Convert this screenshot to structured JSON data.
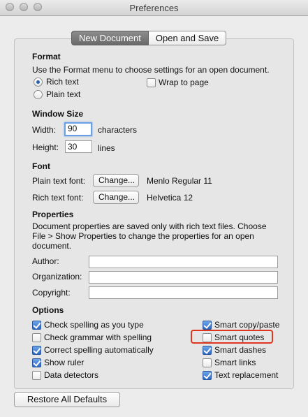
{
  "window": {
    "title": "Preferences"
  },
  "tabs": [
    {
      "label": "New Document",
      "active": true
    },
    {
      "label": "Open and Save",
      "active": false
    }
  ],
  "format": {
    "heading": "Format",
    "description": "Use the Format menu to choose settings for an open document.",
    "rich_text": "Rich text",
    "plain_text": "Plain text",
    "wrap_to_page": "Wrap to page",
    "selected": "Rich text",
    "wrap_checked": false
  },
  "window_size": {
    "heading": "Window Size",
    "width_label": "Width:",
    "width_value": "90",
    "width_unit": "characters",
    "height_label": "Height:",
    "height_value": "30",
    "height_unit": "lines"
  },
  "font": {
    "heading": "Font",
    "plain_label": "Plain text font:",
    "plain_button": "Change...",
    "plain_value": "Menlo Regular 11",
    "rich_label": "Rich text font:",
    "rich_button": "Change...",
    "rich_value": "Helvetica 12"
  },
  "properties": {
    "heading": "Properties",
    "desc_line1": "Document properties are saved only with rich text files. Choose",
    "desc_line2": "File > Show Properties to change the properties for an open",
    "desc_line3": "document.",
    "author_label": "Author:",
    "author_value": "",
    "organization_label": "Organization:",
    "organization_value": "",
    "copyright_label": "Copyright:",
    "copyright_value": ""
  },
  "options": {
    "heading": "Options",
    "left": [
      {
        "label": "Check spelling as you type",
        "checked": true
      },
      {
        "label": "Check grammar with spelling",
        "checked": false
      },
      {
        "label": "Correct spelling automatically",
        "checked": true
      },
      {
        "label": "Show ruler",
        "checked": true
      },
      {
        "label": "Data detectors",
        "checked": false
      }
    ],
    "right": [
      {
        "label": "Smart copy/paste",
        "checked": true
      },
      {
        "label": "Smart quotes",
        "checked": false
      },
      {
        "label": "Smart dashes",
        "checked": true
      },
      {
        "label": "Smart links",
        "checked": false
      },
      {
        "label": "Text replacement",
        "checked": true
      }
    ]
  },
  "footer": {
    "restore_label": "Restore All Defaults"
  },
  "colors": {
    "highlight": "#e0361f",
    "accent": "#2c69c4"
  }
}
